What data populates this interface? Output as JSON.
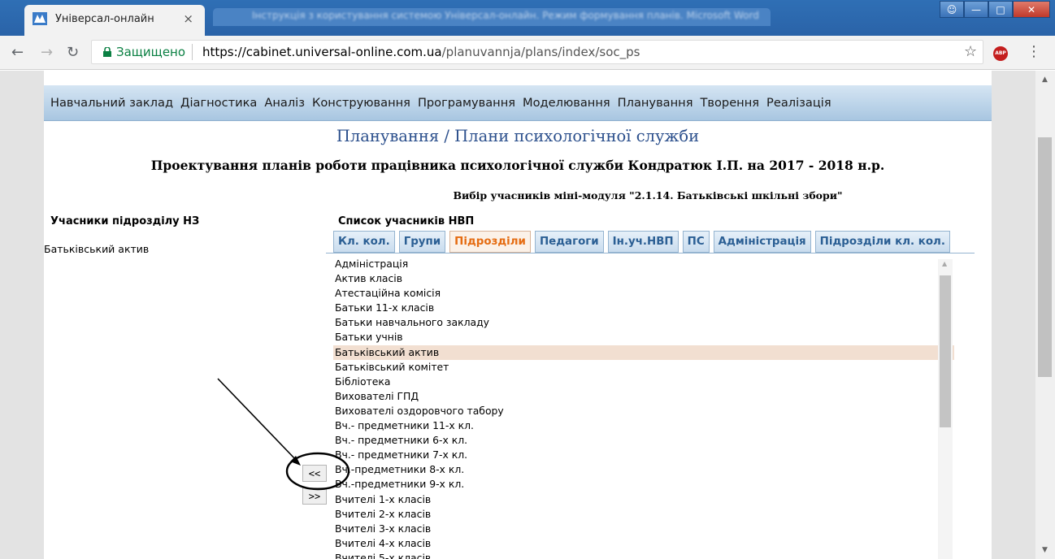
{
  "browser": {
    "tab_title": "Універсал-онлайн",
    "inactive_tab_text": "Інструкція з користування системою Універсал-онлайн. Режим формування планів. Microsoft Word",
    "secure_label": "Защищено",
    "url_host": "https://cabinet.universal-online.com.ua",
    "url_path": "/planuvannja/plans/index/soc_ps",
    "abp_label": "ABP"
  },
  "menu": [
    "Навчальний заклад",
    "Діагностика",
    "Аналіз",
    "Конструювання",
    "Програмування",
    "Моделювання",
    "Планування",
    "Творення",
    "Реалізація"
  ],
  "breadcrumb": "Планування / Плани психологічної служби",
  "heading": "Проектування планів роботи працівника психологічної служби Кондратюк І.П. на 2017 - 2018 н.р.",
  "subheading": "Вибір учасників міні-модуля \"2.1.14. Батьківські шкільні збори\"",
  "left_panel": {
    "title": "Учасники підрозділу НЗ",
    "items": [
      "Батьківський актив"
    ]
  },
  "right_panel": {
    "title": "Список учасників НВП",
    "tabs": [
      "Кл. кол.",
      "Групи",
      "Підрозділи",
      "Педагоги",
      "Ін.уч.НВП",
      "ПС",
      "Адміністрація",
      "Підрозділи кл. кол."
    ],
    "active_tab": "Підрозділи",
    "selected_item": "Батьківський актив",
    "items": [
      "Адміністрація",
      "Актив класів",
      "Атестаційна комісія",
      "Батьки 11-х класів",
      "Батьки навчального закладу",
      "Батьки учнів",
      "Батьківський актив",
      "Батьківський комітет",
      "Бібліотека",
      "Вихователі ГПД",
      "Вихователі оздоровчого табору",
      "Вч.- предметники 11-х кл.",
      "Вч.- предметники 6-х кл.",
      "Вч.- предметники 7-х кл.",
      "Вч.-предметники 8-х кл.",
      "Вч.-предметники 9-х кл.",
      "Вчителі 1-х класів",
      "Вчителі 2-х класів",
      "Вчителі 3-х класів",
      "Вчителі 4-х класів",
      "Вчителі 5-х класів"
    ]
  },
  "buttons": {
    "add": "<<",
    "remove": ">>"
  }
}
